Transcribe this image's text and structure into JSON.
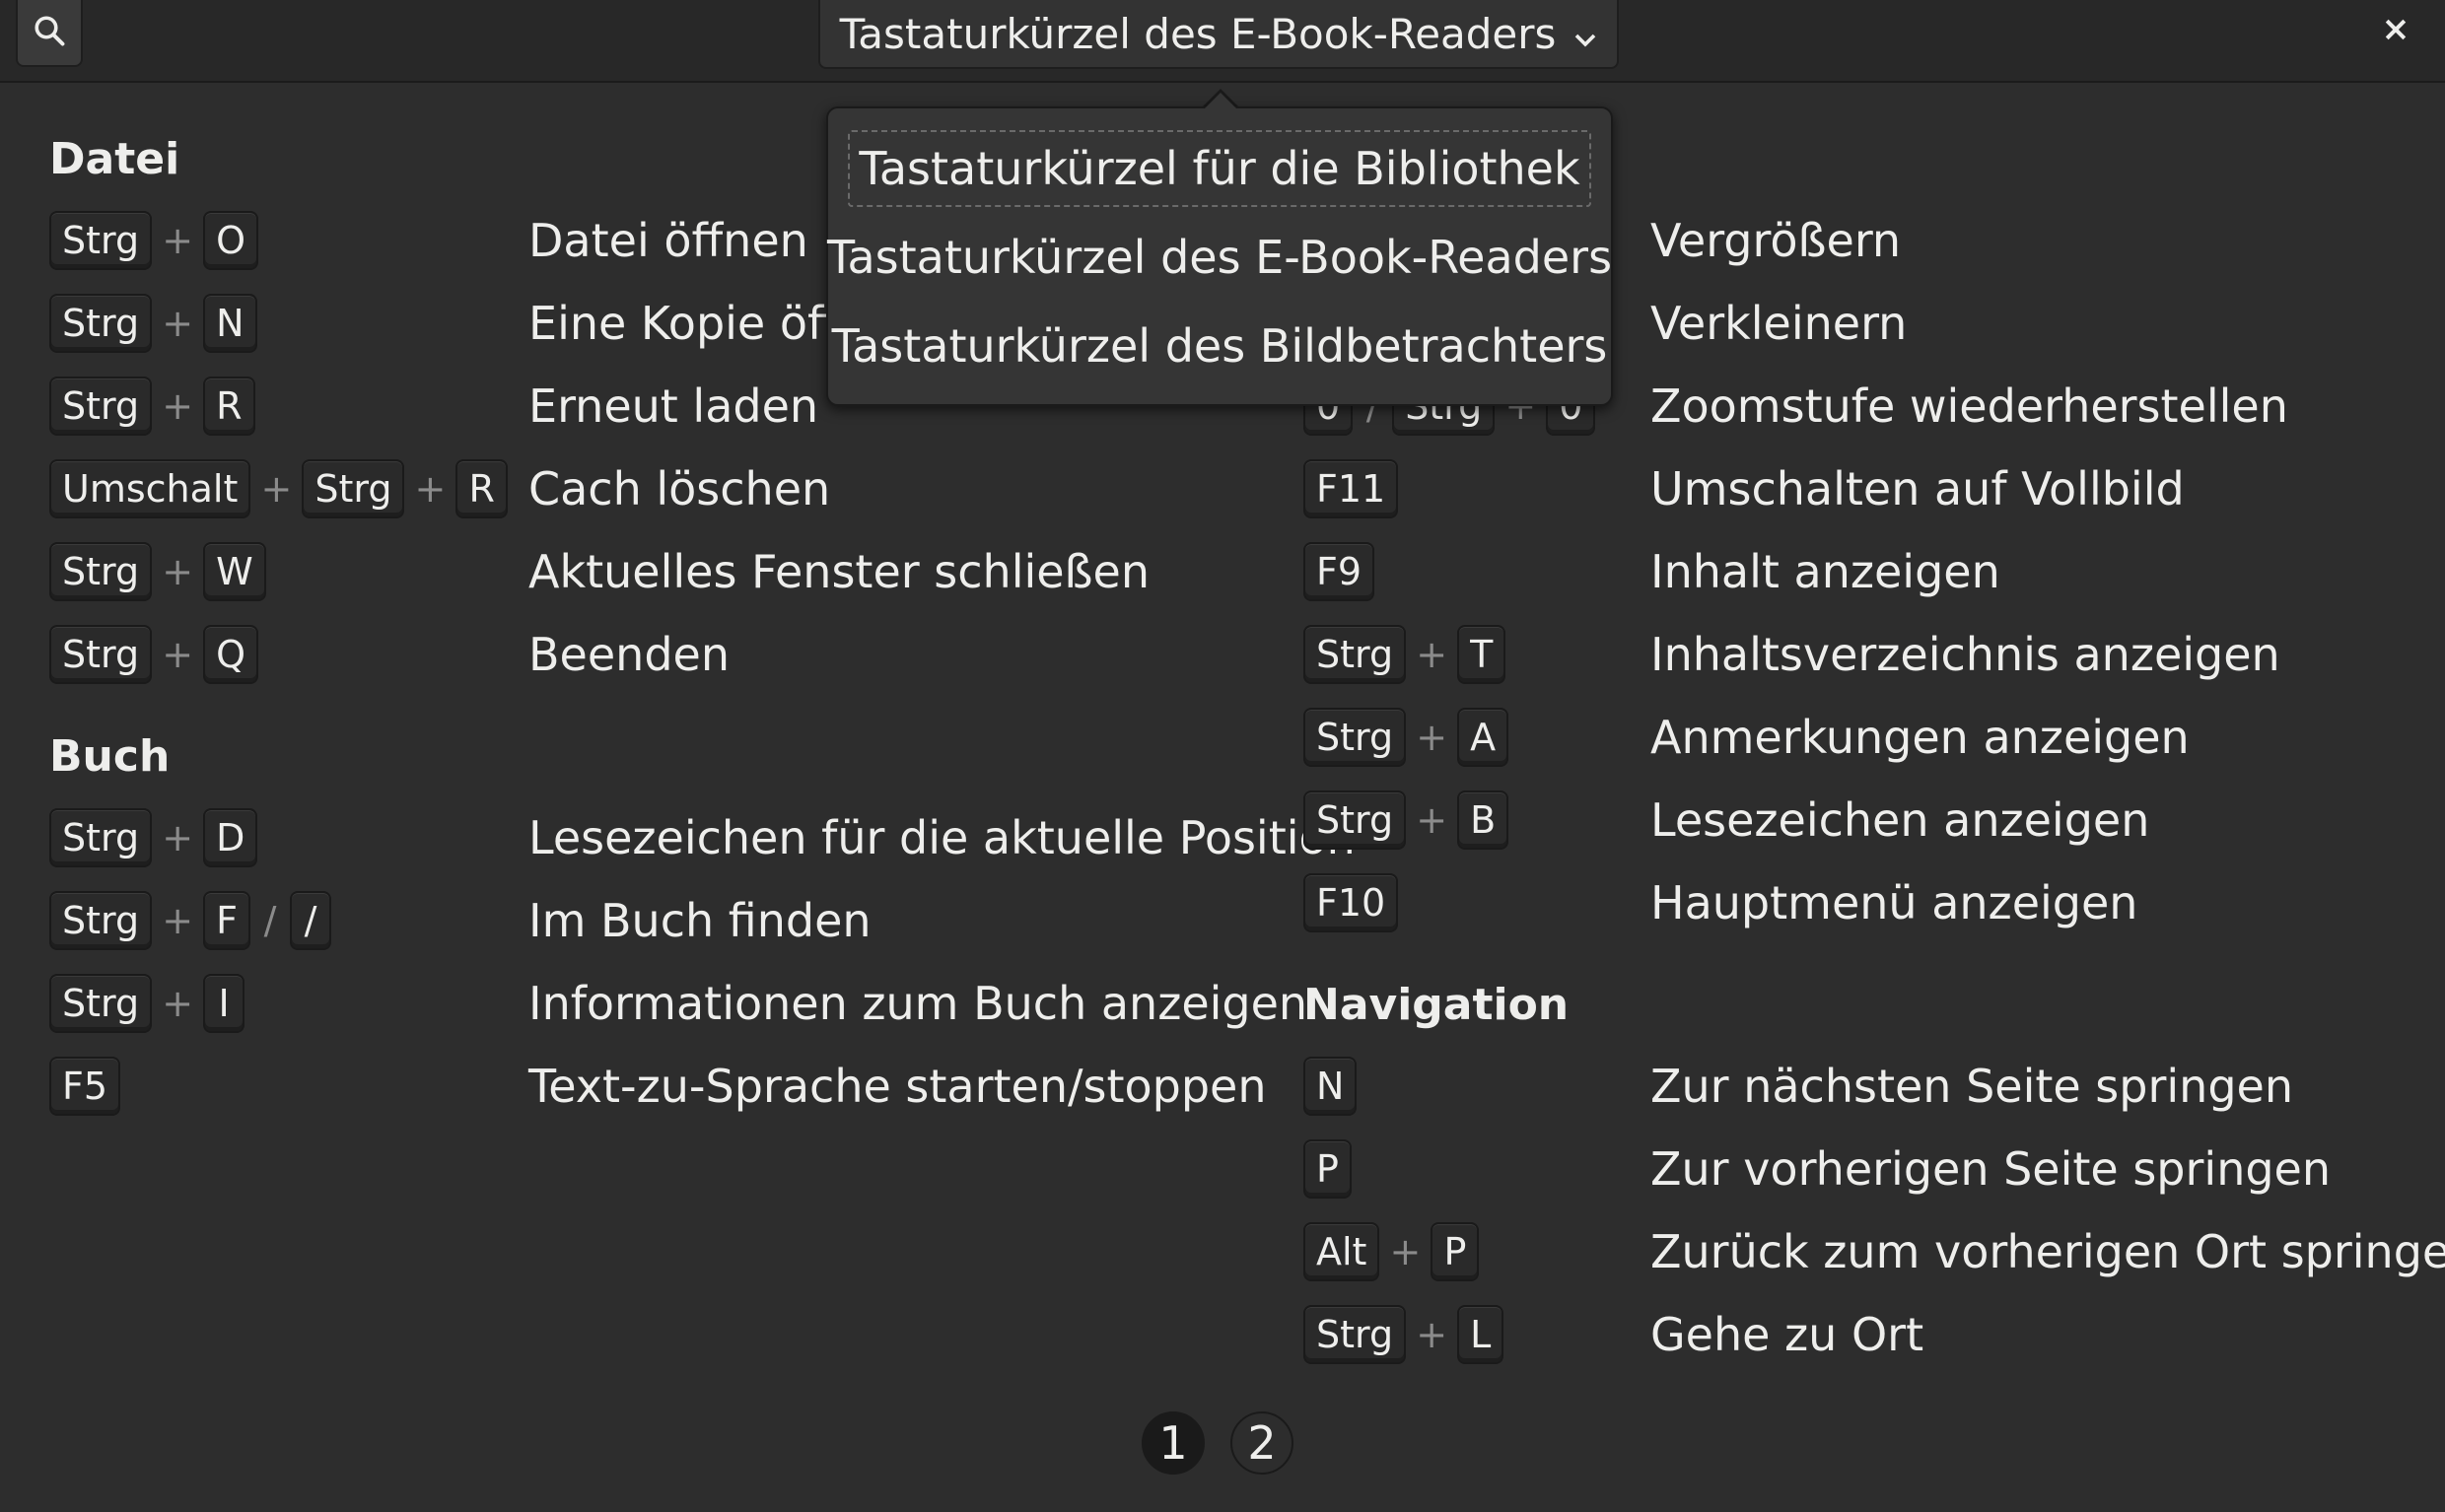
{
  "header": {
    "title": "Tastaturkürzel des E-Book-Readers",
    "search_icon": "search-icon",
    "dropdown_icon": "chevron-down-icon",
    "close_icon": "close-icon",
    "close_glyph": "×"
  },
  "popover": {
    "items": [
      "Tastaturkürzel für die Bibliothek",
      "Tastaturkürzel des E-Book-Readers",
      "Tastaturkürzel des Bildbetrachters"
    ]
  },
  "sections": {
    "datei": "Datei",
    "buch": "Buch",
    "navigation": "Navigation"
  },
  "shortcuts": {
    "datei": [
      {
        "keys": [
          "Strg",
          "O"
        ],
        "label": "Datei öffnen"
      },
      {
        "keys": [
          "Strg",
          "N"
        ],
        "label": "Eine Kopie öffnen"
      },
      {
        "keys": [
          "Strg",
          "R"
        ],
        "label": "Erneut laden"
      },
      {
        "keys": [
          "Umschalt",
          "Strg",
          "R"
        ],
        "label": "Cach löschen"
      },
      {
        "keys": [
          "Strg",
          "W"
        ],
        "label": "Aktuelles Fenster schließen"
      },
      {
        "keys": [
          "Strg",
          "Q"
        ],
        "label": "Beenden"
      }
    ],
    "buch": [
      {
        "keys": [
          "Strg",
          "D"
        ],
        "label": "Lesezeichen für die aktuelle Position"
      },
      {
        "keys": [
          "Strg",
          "F",
          "/"
        ],
        "label": "Im Buch finden"
      },
      {
        "keys": [
          "Strg",
          "I"
        ],
        "label": "Informationen zum Buch anzeigen"
      },
      {
        "keys": [
          "F5"
        ],
        "label": "Text-zu-Sprache starten/stoppen"
      }
    ],
    "ansicht": [
      {
        "keys": [
          "+"
        ],
        "label": "Vergrößern"
      },
      {
        "keys": [
          "-"
        ],
        "label": "Verkleinern"
      },
      {
        "keys": [
          "0",
          "Strg",
          "0"
        ],
        "label": "Zoomstufe wiederherstellen"
      },
      {
        "keys": [
          "F11"
        ],
        "label": "Umschalten auf Vollbild"
      },
      {
        "keys": [
          "F9"
        ],
        "label": "Inhalt anzeigen"
      },
      {
        "keys": [
          "Strg",
          "T"
        ],
        "label": "Inhaltsverzeichnis anzeigen"
      },
      {
        "keys": [
          "Strg",
          "A"
        ],
        "label": "Anmerkungen anzeigen"
      },
      {
        "keys": [
          "Strg",
          "B"
        ],
        "label": "Lesezeichen anzeigen"
      },
      {
        "keys": [
          "F10"
        ],
        "label": "Hauptmenü anzeigen"
      }
    ],
    "navigation": [
      {
        "keys": [
          "N"
        ],
        "label": "Zur nächsten Seite springen"
      },
      {
        "keys": [
          "P"
        ],
        "label": "Zur vorherigen Seite springen"
      },
      {
        "keys": [
          "Alt",
          "P"
        ],
        "label": "Zurück zum vorherigen Ort springen"
      },
      {
        "keys": [
          "Strg",
          "L"
        ],
        "label": "Gehe zu Ort"
      }
    ]
  },
  "separators": {
    "plus": "+",
    "slash": "/"
  },
  "pager": {
    "page1": "1",
    "page2": "2",
    "active": "1"
  }
}
